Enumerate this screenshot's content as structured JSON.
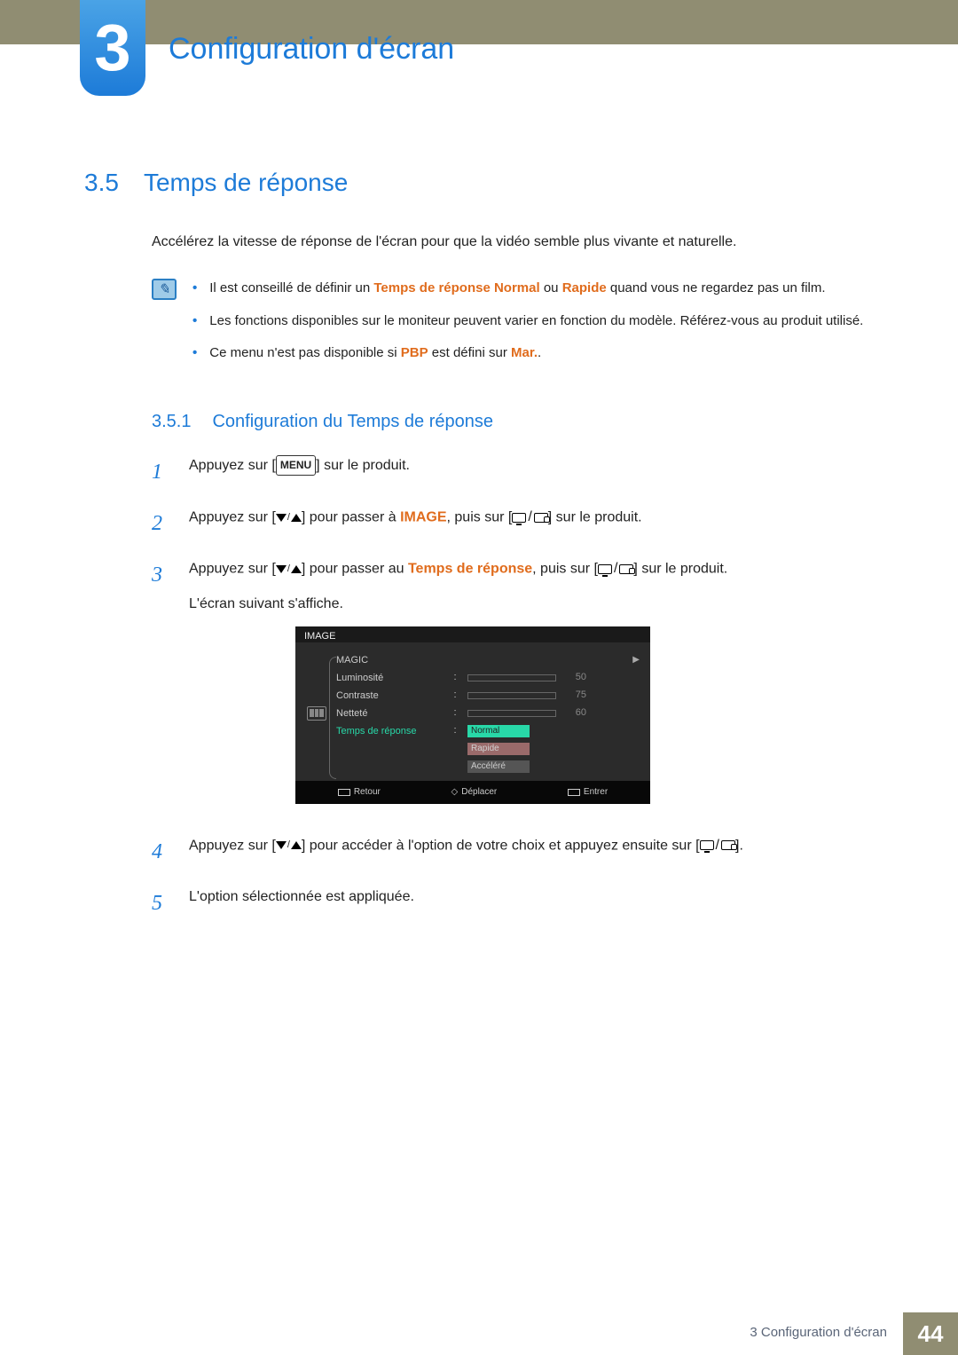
{
  "chapter": {
    "number": "3",
    "title": "Configuration d'écran"
  },
  "section": {
    "number": "3.5",
    "title": "Temps de réponse"
  },
  "intro": "Accélérez la vitesse de réponse de l'écran pour que la vidéo semble plus vivante et naturelle.",
  "notes": {
    "a_pre": "Il est conseillé de définir un ",
    "a_hl1": "Temps de réponse Normal",
    "a_mid": " ou ",
    "a_hl2": "Rapide",
    "a_post": " quand vous ne regardez pas un film.",
    "b": "Les fonctions disponibles sur le moniteur peuvent varier en fonction du modèle. Référez-vous au produit utilisé.",
    "c_pre": "Ce menu n'est pas disponible si ",
    "c_hl1": "PBP",
    "c_mid": " est défini sur ",
    "c_hl2": "Mar.",
    "c_post": "."
  },
  "subsection": {
    "number": "3.5.1",
    "title": "Configuration du Temps de réponse"
  },
  "steps": {
    "s1": {
      "pre": "Appuyez sur [",
      "cap": "MENU",
      "post": "] sur le produit."
    },
    "s2": {
      "pre": "Appuyez sur [",
      "mid": "] pour passer à ",
      "hl": "IMAGE",
      "mid2": ", puis sur [",
      "post": "] sur le produit."
    },
    "s3": {
      "pre": "Appuyez sur [",
      "mid": "] pour passer au ",
      "hl": "Temps de réponse",
      "mid2": ", puis sur [",
      "post": "] sur le produit.",
      "extra": "L'écran suivant s'affiche."
    },
    "s4": {
      "pre": "Appuyez sur [",
      "mid": "] pour accéder à l'option de votre choix et appuyez ensuite sur [",
      "post": "]."
    },
    "s5": "L'option sélectionnée est appliquée."
  },
  "osd": {
    "header": "IMAGE",
    "items": [
      {
        "label": "MAGIC",
        "type": "arrow"
      },
      {
        "label": "Luminosité",
        "type": "bar",
        "value": 50,
        "max": 100
      },
      {
        "label": "Contraste",
        "type": "bar",
        "value": 75,
        "max": 100
      },
      {
        "label": "Netteté",
        "type": "bar",
        "value": 60,
        "max": 100
      },
      {
        "label": "Temps de réponse",
        "type": "options",
        "highlighted": true
      }
    ],
    "options": [
      {
        "label": "Normal",
        "state": "sel"
      },
      {
        "label": "Rapide",
        "state": "hl"
      },
      {
        "label": "Accéléré",
        "state": "acc"
      }
    ],
    "footer": {
      "back": "Retour",
      "move": "Déplacer",
      "enter": "Entrer"
    }
  },
  "footer": {
    "label": "3 Configuration d'écran",
    "page": "44"
  }
}
